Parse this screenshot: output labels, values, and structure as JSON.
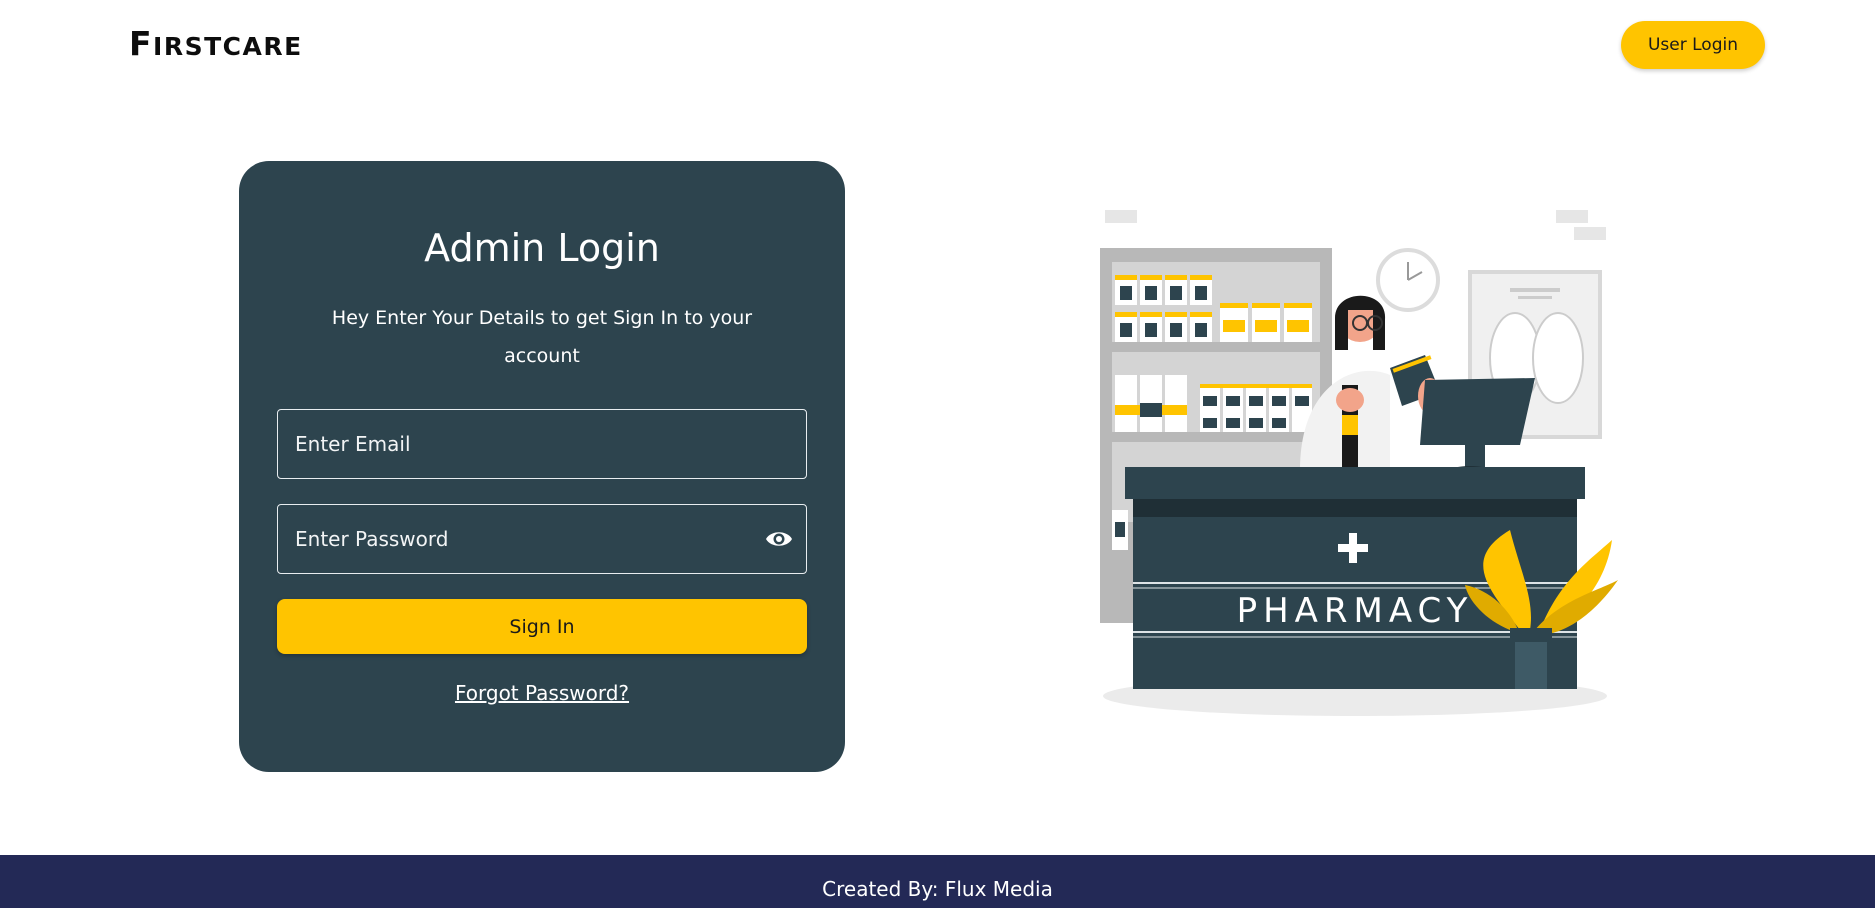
{
  "header": {
    "logo_first": "F",
    "logo_rest": "IRSTCARE",
    "user_login_label": "User Login"
  },
  "login": {
    "title": "Admin Login",
    "subtitle": "Hey Enter Your Details to get Sign In to your account",
    "email_placeholder": "Enter Email",
    "password_placeholder": "Enter Password",
    "signin_label": "Sign In",
    "forgot_label": "Forgot Password?"
  },
  "illustration": {
    "sign_text": "PHARMACY",
    "icon": "pharmacist-illustration"
  },
  "colors": {
    "accent": "#ffc400",
    "card": "#2d444e",
    "footer": "#232956"
  },
  "footer": {
    "credit": "Created By: Flux Media"
  }
}
